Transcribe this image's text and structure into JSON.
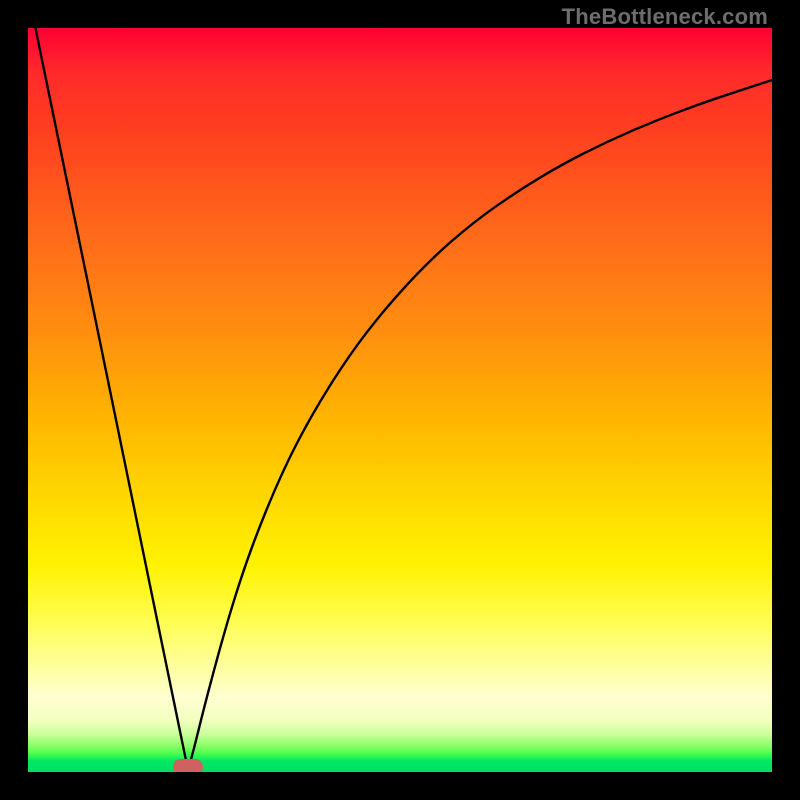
{
  "attribution": "TheBottleneck.com",
  "chart_data": {
    "type": "line",
    "title": "",
    "xlabel": "",
    "ylabel": "",
    "xlim": [
      0,
      1
    ],
    "ylim": [
      0,
      1
    ],
    "marker": {
      "x": 0.215,
      "y": 0.007
    },
    "series": [
      {
        "name": "curve",
        "points": [
          {
            "x": 0.01,
            "y": 1.0
          },
          {
            "x": 0.06,
            "y": 0.757
          },
          {
            "x": 0.11,
            "y": 0.514
          },
          {
            "x": 0.16,
            "y": 0.27
          },
          {
            "x": 0.21,
            "y": 0.027
          },
          {
            "x": 0.215,
            "y": 0.003
          },
          {
            "x": 0.222,
            "y": 0.027
          },
          {
            "x": 0.24,
            "y": 0.1
          },
          {
            "x": 0.27,
            "y": 0.21
          },
          {
            "x": 0.3,
            "y": 0.302
          },
          {
            "x": 0.34,
            "y": 0.4
          },
          {
            "x": 0.38,
            "y": 0.478
          },
          {
            "x": 0.43,
            "y": 0.558
          },
          {
            "x": 0.48,
            "y": 0.623
          },
          {
            "x": 0.54,
            "y": 0.688
          },
          {
            "x": 0.6,
            "y": 0.74
          },
          {
            "x": 0.66,
            "y": 0.782
          },
          {
            "x": 0.72,
            "y": 0.818
          },
          {
            "x": 0.78,
            "y": 0.848
          },
          {
            "x": 0.84,
            "y": 0.874
          },
          {
            "x": 0.9,
            "y": 0.897
          },
          {
            "x": 0.96,
            "y": 0.917
          },
          {
            "x": 1.0,
            "y": 0.93
          }
        ]
      }
    ],
    "gradient_stops": [
      {
        "pos": 0.0,
        "color": "#ff0033"
      },
      {
        "pos": 0.5,
        "color": "#ffcc00"
      },
      {
        "pos": 0.8,
        "color": "#fff760"
      },
      {
        "pos": 0.97,
        "color": "#70ff60"
      },
      {
        "pos": 1.0,
        "color": "#00dd66"
      }
    ]
  }
}
